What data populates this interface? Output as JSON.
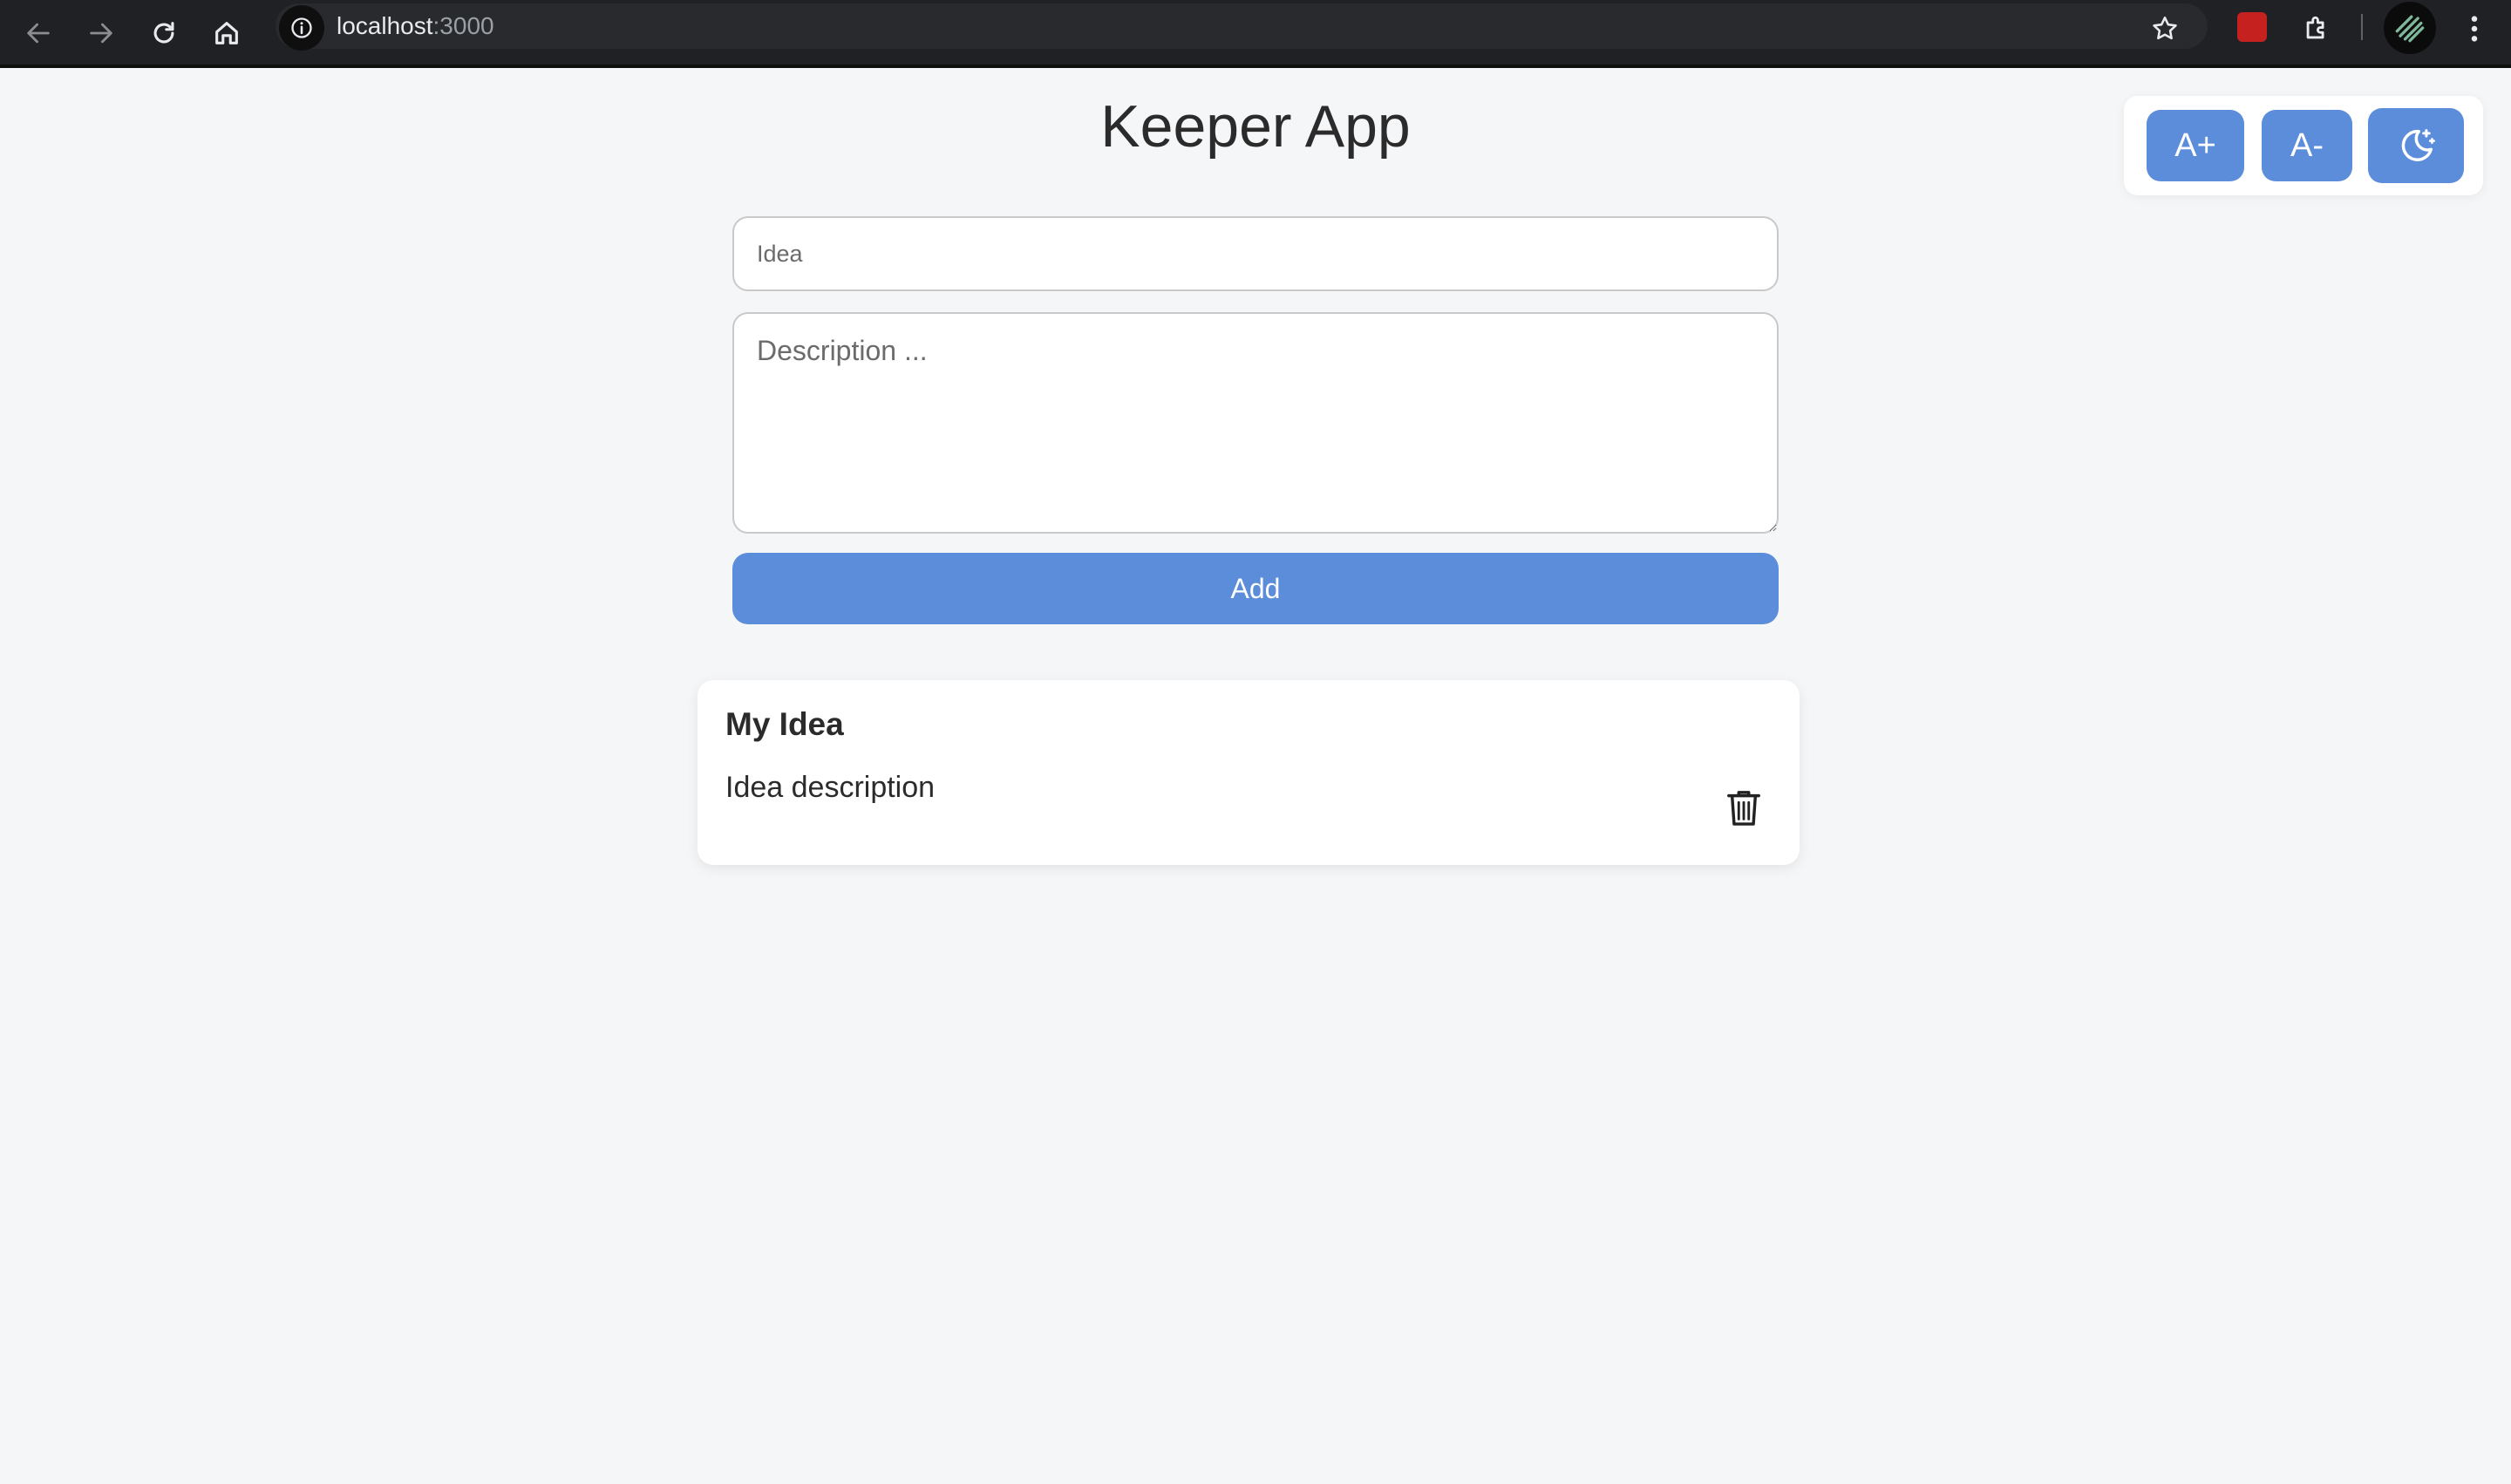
{
  "browser": {
    "url_host": "localhost",
    "url_port": ":3000",
    "icons": {
      "back": "arrow-left-icon",
      "forward": "arrow-right-icon",
      "reload": "reload-icon",
      "home": "home-icon",
      "site_info": "info-icon",
      "bookmark": "star-icon",
      "extension": "extension-icon",
      "extensions": "puzzle-icon",
      "profile": "profile-avatar",
      "menu": "kebab-menu-icon"
    }
  },
  "app": {
    "title": "Keeper App",
    "accent_color": "#5b8ddb",
    "background_color": "#f5f6f8"
  },
  "toolbar": {
    "increase_font_label": "A+",
    "decrease_font_label": "A-",
    "dark_mode_icon": "moon-stars-icon"
  },
  "form": {
    "idea_placeholder": "Idea",
    "idea_value": "",
    "description_placeholder": "Description ...",
    "description_value": "",
    "add_label": "Add"
  },
  "notes": [
    {
      "title": "My Idea",
      "description": "Idea description",
      "delete_icon": "trash-icon"
    }
  ]
}
